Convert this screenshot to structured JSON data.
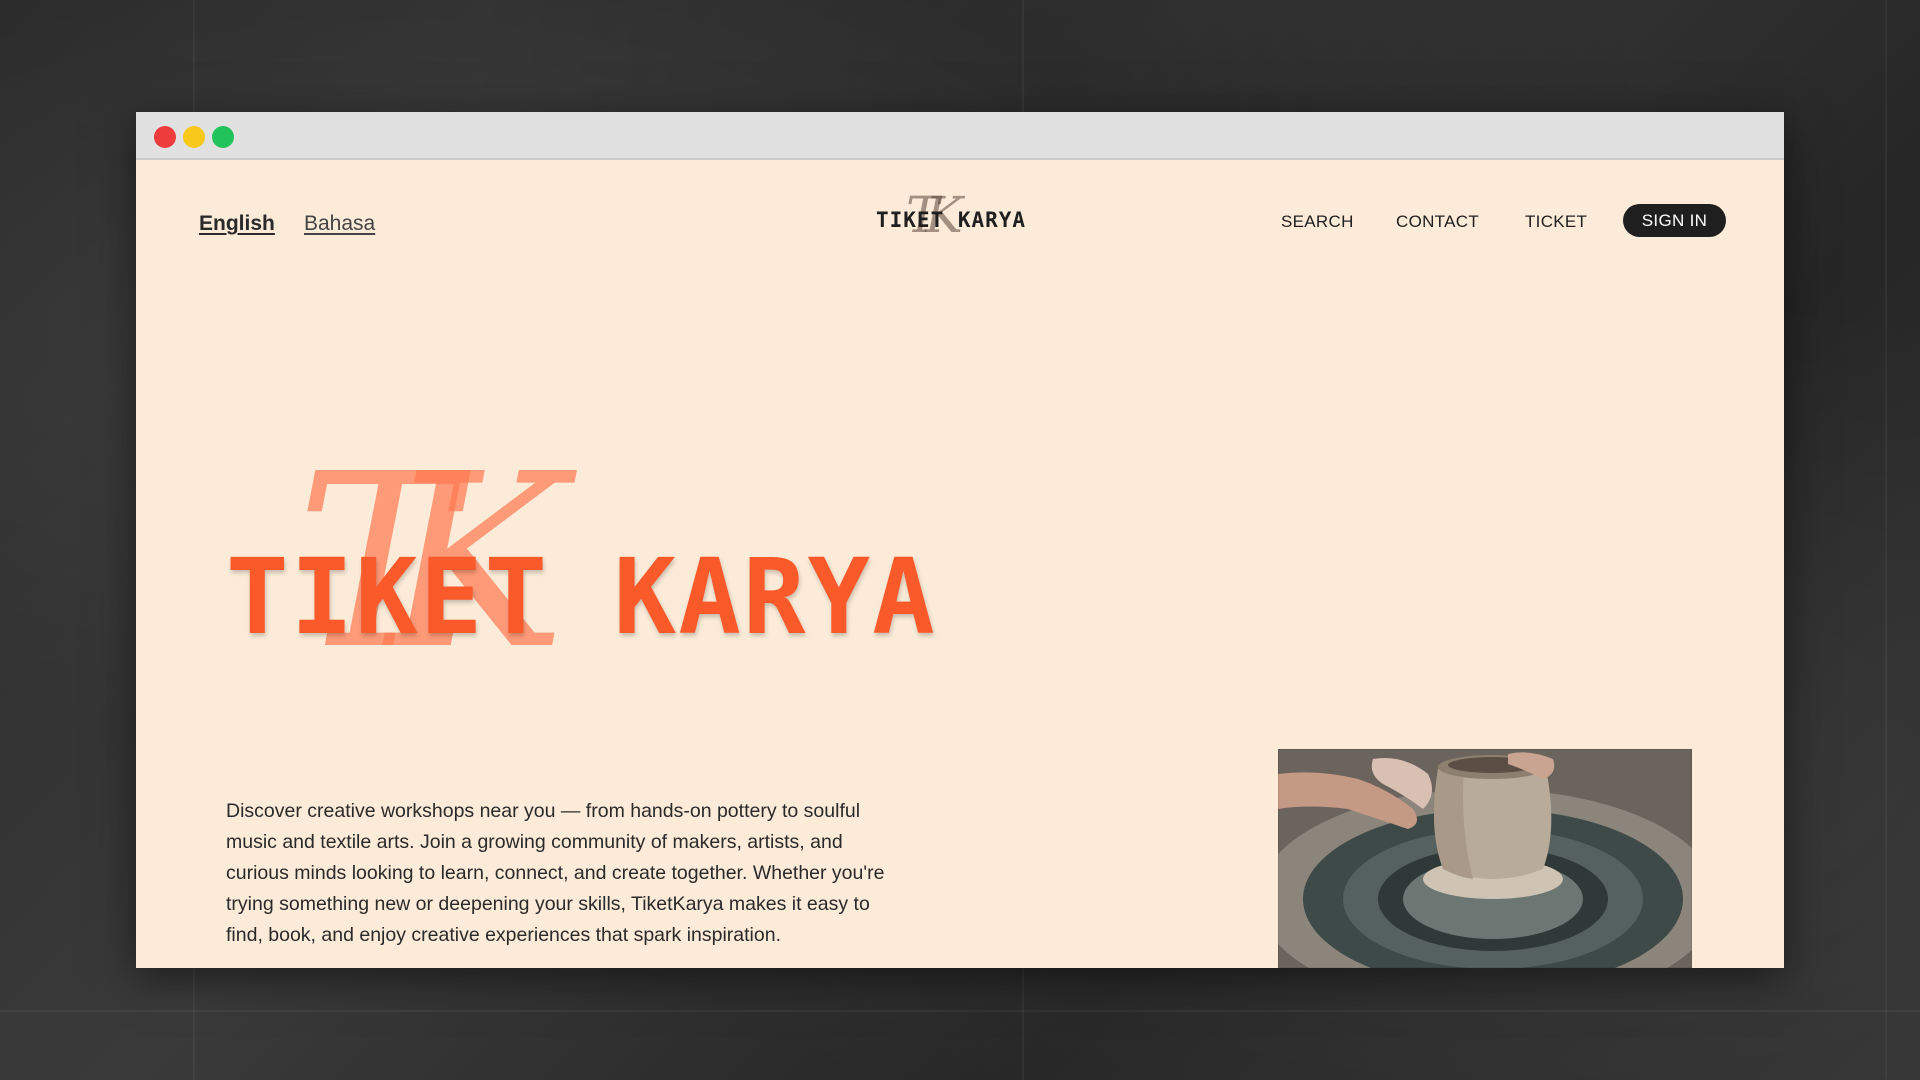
{
  "language_switcher": {
    "english": "English",
    "bahasa": "Bahasa"
  },
  "brand": {
    "logo_text": "TIKET KARYA",
    "monogram": "TK",
    "hero_title": "TIKET KARYA"
  },
  "nav": {
    "search": "SEARCH",
    "contact": "CONTACT",
    "ticket": "TICKET",
    "sign_in": "SIGN IN"
  },
  "hero": {
    "description": "Discover creative workshops near you — from hands-on pottery to soulful music and textile arts. Join a growing community of makers, artists, and curious minds looking to learn, connect, and create together. Whether you're trying something new or deepening your skills, TiketKarya makes it easy to find, book, and enjoy creative experiences that spark inspiration."
  },
  "colors": {
    "page_background": "#fcebd8",
    "accent": "#fa5a2a",
    "sign_in_background": "#1f1f1f"
  },
  "images": {
    "hero_photo": "pottery-wheel-photo"
  }
}
